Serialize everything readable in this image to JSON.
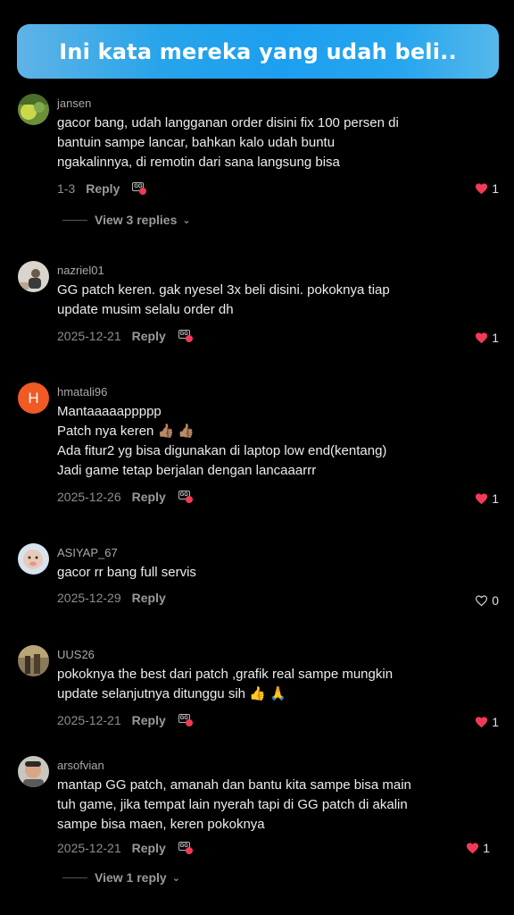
{
  "banner": {
    "title": "Ini kata mereka yang udah beli.."
  },
  "comments": [
    {
      "username": "jansen",
      "lines": [
        "gacor bang, udah langganan order disini fix 100 persen di",
        "bantuin sampe lancar, bahkan kalo udah buntu",
        "ngakalinnya, di remotin dari sana langsung bisa"
      ],
      "date": "1-3",
      "reply_label": "Reply",
      "likes": "1",
      "liked": true,
      "view_replies": "View 3 replies"
    },
    {
      "username": "nazriel01",
      "lines": [
        "GG patch keren. gak nyesel 3x beli disini. pokoknya tiap",
        "update musim selalu order dh"
      ],
      "date": "2025-12-21",
      "reply_label": "Reply",
      "likes": "1",
      "liked": true
    },
    {
      "username": "hmatali96",
      "avatar_letter": "H",
      "lines": [
        "Mantaaaaappppp",
        "Patch nya keren 👍🏽 👍🏽",
        "Ada fitur2 yg bisa digunakan di laptop low end(kentang)",
        "Jadi game tetap berjalan dengan lancaaarrr"
      ],
      "date": "2025-12-26",
      "reply_label": "Reply",
      "likes": "1",
      "liked": true
    },
    {
      "username": "ASIYAP_67",
      "lines": [
        "gacor rr bang full servis"
      ],
      "date": "2025-12-29",
      "reply_label": "Reply",
      "likes": "0",
      "liked": false
    },
    {
      "username": "UUS26",
      "lines": [
        "pokoknya the best dari patch ,grafik real sampe mungkin",
        "update selanjutnya ditunggu sih 👍 🙏"
      ],
      "date": "2025-12-21",
      "reply_label": "Reply",
      "likes": "1",
      "liked": true
    },
    {
      "username": "arsofvian",
      "lines": [
        "mantap GG patch, amanah dan bantu kita sampe bisa main",
        "tuh game, jika tempat lain nyerah tapi di GG patch di akalin",
        "sampe bisa maen, keren pokoknya"
      ],
      "date": "2025-12-21",
      "reply_label": "Reply",
      "likes": "1",
      "liked": true,
      "view_replies": "View 1 reply"
    }
  ],
  "icons": {
    "like": "heart-icon",
    "badge": "gg-creator-badge-icon",
    "expand": "chevron-down-icon"
  },
  "colors": {
    "banner": "#1d9ff0",
    "heart": "#f03a58",
    "avatar_h": "#f15a24",
    "background": "#000000"
  }
}
